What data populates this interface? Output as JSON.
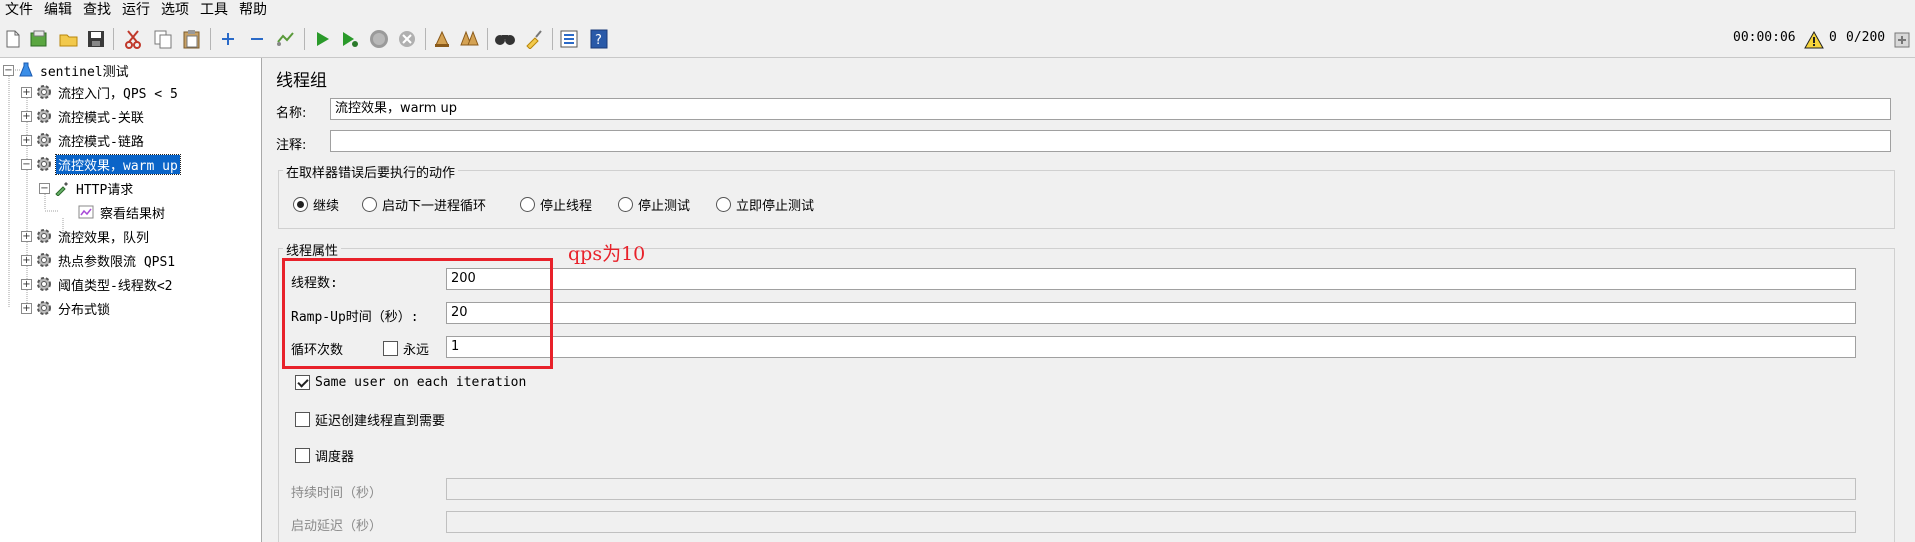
{
  "menu": [
    "文件",
    "编辑",
    "查找",
    "运行",
    "选项",
    "工具",
    "帮助"
  ],
  "toolbar": {
    "icons": [
      "new-icon",
      "templates-icon",
      "open-icon",
      "save-icon",
      "cut-icon",
      "copy-icon",
      "paste-icon",
      "expand-icon",
      "collapse-icon",
      "toggle-icon",
      "start-icon",
      "start-no-pause-icon",
      "stop-icon",
      "shutdown-icon",
      "clear-icon",
      "clear-all-icon",
      "search-icon",
      "reset-search-icon",
      "function-helper-icon",
      "help-icon"
    ],
    "timer": "00:00:06",
    "warning_count": "0",
    "threads": "0/200"
  },
  "tree": {
    "root": "sentinel测试",
    "items": [
      {
        "label": "流控入门，QPS < 5"
      },
      {
        "label": "流控模式-关联"
      },
      {
        "label": "流控模式-链路"
      },
      {
        "label": "流控效果，warm up",
        "selected": true
      },
      {
        "label": "HTTP请求"
      },
      {
        "label": "察看结果树"
      },
      {
        "label": "流控效果，队列"
      },
      {
        "label": "热点参数限流 QPS1"
      },
      {
        "label": "阈值类型-线程数<2"
      },
      {
        "label": "分布式锁"
      }
    ]
  },
  "panel": {
    "title": "线程组",
    "name_label": "名称:",
    "name_value": "流控效果，warm up",
    "comment_label": "注释:",
    "comment_value": "",
    "error_action": {
      "title": "在取样器错误后要执行的动作",
      "options": [
        "继续",
        "启动下一进程循环",
        "停止线程",
        "停止测试",
        "立即停止测试"
      ],
      "selected": 0
    },
    "thread_props": {
      "title": "线程属性",
      "threads_label": "线程数:",
      "threads_value": "200",
      "rampup_label": "Ramp-Up时间（秒）:",
      "rampup_value": "20",
      "loop_label": "循环次数",
      "forever_label": "永远",
      "forever_checked": false,
      "loop_value": "1"
    },
    "same_user_label": "Same user on each iteration",
    "same_user_checked": true,
    "delay_label": "延迟创建线程直到需要",
    "delay_checked": false,
    "scheduler_label": "调度器",
    "scheduler_checked": false,
    "duration_label": "持续时间（秒）",
    "startup_delay_label": "启动延迟（秒）"
  },
  "annotation": {
    "text": "qps为10",
    "color": "#e8212a"
  }
}
